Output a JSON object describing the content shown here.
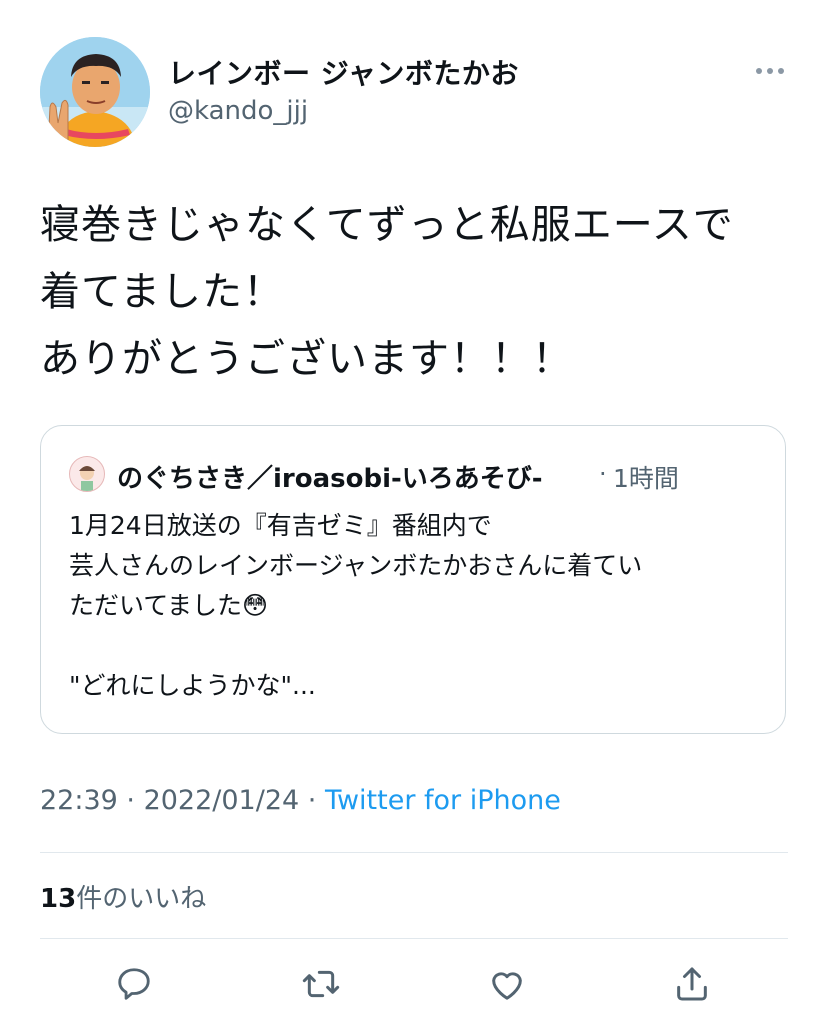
{
  "tweet": {
    "display_name": "レインボー ジャンボたかお",
    "handle": "@kando_jjj",
    "text_lines": [
      "寝巻きじゃなくてずっと私服エースで",
      "着てました！",
      "ありがとうございます！！！"
    ]
  },
  "quoted": {
    "display_name": "のぐちさき／iroasobi-いろあそび-",
    "dot": "·",
    "time": "1時間",
    "lines": [
      "1月24日放送の『有吉ゼミ』番組内で",
      "芸人さんのレインボージャンボたかおさんに着てい",
      "ただいてました😳",
      "",
      "\"どれにしようかな\"..."
    ]
  },
  "meta": {
    "time": "22:39",
    "sep1": " · ",
    "date": "2022/01/24",
    "sep2": " · ",
    "source": "Twitter for iPhone"
  },
  "likes": {
    "count": "13",
    "label": "件のいいね"
  },
  "icons": {
    "more": "more-icon",
    "reply": "reply-icon",
    "retweet": "retweet-icon",
    "like": "like-icon",
    "share": "share-icon",
    "accent_color": "#1d9bf0",
    "icon_color": "#536471"
  }
}
